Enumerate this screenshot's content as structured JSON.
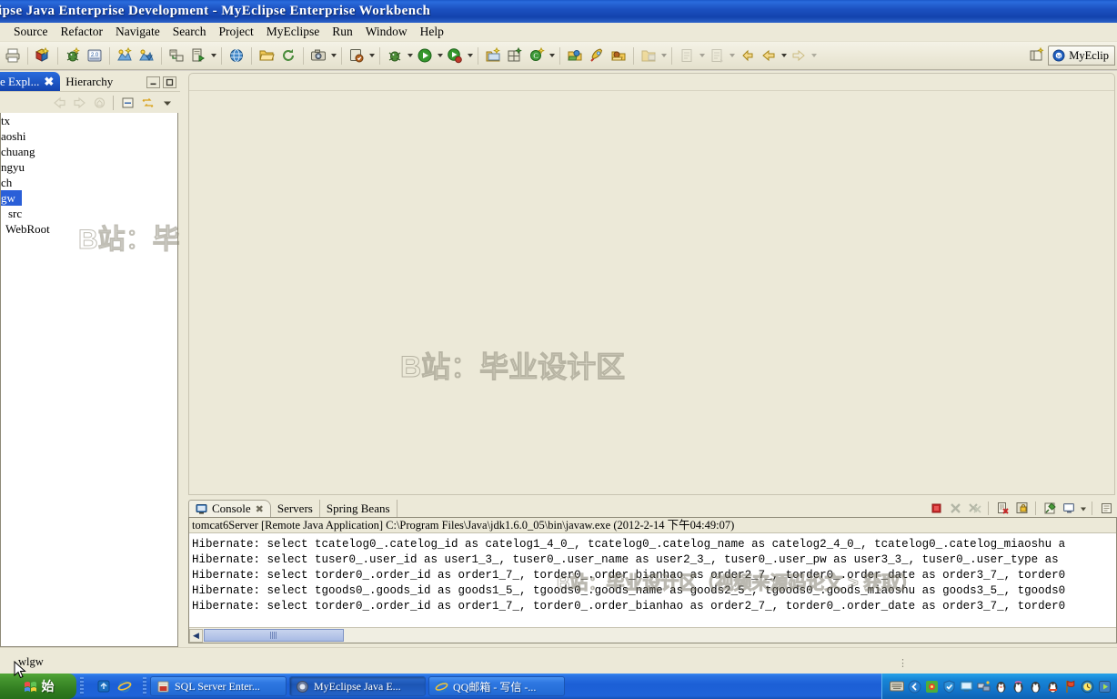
{
  "window": {
    "title": "ipse Java Enterprise Development - MyEclipse Enterprise Workbench"
  },
  "menubar": {
    "items": [
      {
        "label": "Source"
      },
      {
        "label": "Refactor"
      },
      {
        "label": "Navigate"
      },
      {
        "label": "Search"
      },
      {
        "label": "Project"
      },
      {
        "label": "MyEclipse"
      },
      {
        "label": "Run"
      },
      {
        "label": "Window"
      },
      {
        "label": "Help"
      }
    ]
  },
  "toolbar": {
    "buttons": [
      {
        "name": "print-icon",
        "glyph": "print"
      },
      {
        "name": "new-wizard-icon",
        "glyph": "newwiz"
      },
      {
        "name": "debug-bug-icon",
        "glyph": "bug"
      },
      {
        "name": "deploy-icon",
        "glyph": "deploy"
      },
      {
        "name": "run-server-icon",
        "glyph": "server1"
      },
      {
        "name": "stop-server-icon",
        "glyph": "server2"
      },
      {
        "name": "database-explorer-icon",
        "glyph": "dbexp"
      },
      {
        "name": "run-sql-icon",
        "glyph": "runsql"
      },
      {
        "name": "web-browser-icon",
        "glyph": "globe"
      },
      {
        "name": "open-folder-icon",
        "glyph": "openfolder"
      },
      {
        "name": "refresh-icon",
        "glyph": "refresh"
      },
      {
        "name": "snapshot-icon",
        "glyph": "camera"
      },
      {
        "name": "validate-icon",
        "glyph": "validate"
      },
      {
        "name": "debug-run-icon",
        "glyph": "bug2"
      },
      {
        "name": "run-icon",
        "glyph": "play"
      },
      {
        "name": "run-external-icon",
        "glyph": "playred"
      },
      {
        "name": "new-java-project-icon",
        "glyph": "javaproj"
      },
      {
        "name": "new-package-icon",
        "glyph": "package"
      },
      {
        "name": "new-class-icon",
        "glyph": "newclass"
      },
      {
        "name": "open-type-icon",
        "glyph": "opentype"
      },
      {
        "name": "search-rocket-icon",
        "glyph": "rocket"
      },
      {
        "name": "open-task-icon",
        "glyph": "opentask"
      },
      {
        "name": "new-folder-icon",
        "glyph": "newfolder"
      },
      {
        "name": "previous-annotation-icon",
        "glyph": "prevannot"
      },
      {
        "name": "next-annotation-icon",
        "glyph": "nextannot"
      },
      {
        "name": "last-edit-location-icon",
        "glyph": "lastedit"
      },
      {
        "name": "back-icon",
        "glyph": "back"
      },
      {
        "name": "forward-icon",
        "glyph": "forward"
      }
    ],
    "perspective": {
      "open_perspective_label": "",
      "active_label": "MyEclip"
    }
  },
  "left_view": {
    "tabs": [
      {
        "label": "e Expl...",
        "active": true,
        "closable": true
      },
      {
        "label": "Hierarchy",
        "active": false,
        "closable": false
      }
    ],
    "toolbar": [
      {
        "name": "back-icon"
      },
      {
        "name": "forward-icon"
      },
      {
        "name": "home-icon"
      },
      {
        "name": "collapse-all-icon"
      },
      {
        "name": "link-with-editor-icon"
      },
      {
        "name": "view-menu-icon"
      }
    ],
    "window_buttons": [
      {
        "name": "minimize-view-button"
      },
      {
        "name": "maximize-view-button"
      }
    ],
    "tree": [
      {
        "label": "tx",
        "selected": false,
        "indent": 0
      },
      {
        "label": "aoshi",
        "selected": false,
        "indent": 0
      },
      {
        "label": "chuang",
        "selected": false,
        "indent": 0
      },
      {
        "label": "ngyu",
        "selected": false,
        "indent": 0
      },
      {
        "label": "ch",
        "selected": false,
        "indent": 0
      },
      {
        "label": "gw",
        "selected": true,
        "indent": 0
      },
      {
        "label": "src",
        "selected": false,
        "indent": 1
      },
      {
        "label": "WebRoot",
        "selected": false,
        "indent": 1
      }
    ]
  },
  "console": {
    "tabs": [
      {
        "label": "Console",
        "active": true,
        "closable": true,
        "icon": "console-icon"
      },
      {
        "label": "Servers",
        "active": false,
        "closable": false
      },
      {
        "label": "Spring Beans",
        "active": false,
        "closable": false
      }
    ],
    "toolbar": [
      {
        "name": "terminate-button",
        "color": "#cc2222"
      },
      {
        "name": "remove-launch-button"
      },
      {
        "name": "remove-all-terminated-button"
      },
      {
        "name": "clear-console-button"
      },
      {
        "name": "scroll-lock-button"
      },
      {
        "name": "pin-console-button"
      },
      {
        "name": "display-selected-console-button"
      },
      {
        "name": "open-console-button"
      }
    ],
    "process_header": "tomcat6Server [Remote Java Application] C:\\Program Files\\Java\\jdk1.6.0_05\\bin\\javaw.exe (2012-2-14 下午04:49:07)",
    "lines": [
      "Hibernate: select tcatelog0_.catelog_id as catelog1_4_0_, tcatelog0_.catelog_name as catelog2_4_0_, tcatelog0_.catelog_miaoshu a",
      "Hibernate: select tuser0_.user_id as user1_3_, tuser0_.user_name as user2_3_, tuser0_.user_pw as user3_3_, tuser0_.user_type as ",
      "Hibernate: select torder0_.order_id as order1_7_, torder0_.order_bianhao as order2_7_, torder0_.order_date as order3_7_, torder0",
      "Hibernate: select tgoods0_.goods_id as goods1_5_, tgoods0_.goods_name as goods2_5_, tgoods0_.goods_miaoshu as goods3_5_, tgoods0",
      "Hibernate: select torder0_.order_id as order1_7_, torder0_.order_bianhao as order2_7_, torder0_.order_date as order3_7_, torder0"
    ],
    "scrollbar": {
      "left_arrow": "◀"
    }
  },
  "statusbar": {
    "text": "wlgw"
  },
  "watermarks": {
    "center": "B站：毕业设计区",
    "left": "B站：毕业设计区",
    "console": "B站：毕业设计区（视频来源码论文 > 获取）"
  },
  "taskbar": {
    "start_label": "始",
    "quick_launch": [
      {
        "name": "show-desktop-icon"
      },
      {
        "name": "internet-explorer-icon"
      }
    ],
    "items": [
      {
        "label": "SQL Server Enter...",
        "icon": "sql-server-icon",
        "active": false
      },
      {
        "label": "MyEclipse Java E...",
        "icon": "myeclipse-icon",
        "active": true
      },
      {
        "label": "QQ邮箱 - 写信 -...",
        "icon": "internet-explorer-icon",
        "active": false
      }
    ],
    "tray": [
      {
        "name": "keyboard-layout-icon"
      },
      {
        "name": "tray-expand-icon"
      },
      {
        "name": "antivirus-icon"
      },
      {
        "name": "shield-icon"
      },
      {
        "name": "monitor-icon"
      },
      {
        "name": "network-icon"
      },
      {
        "name": "qq-icon-1"
      },
      {
        "name": "qq-icon-2"
      },
      {
        "name": "qq-icon-3"
      },
      {
        "name": "qq-icon-4"
      },
      {
        "name": "flag-icon"
      },
      {
        "name": "clock-icon"
      },
      {
        "name": "player-icon"
      }
    ]
  }
}
